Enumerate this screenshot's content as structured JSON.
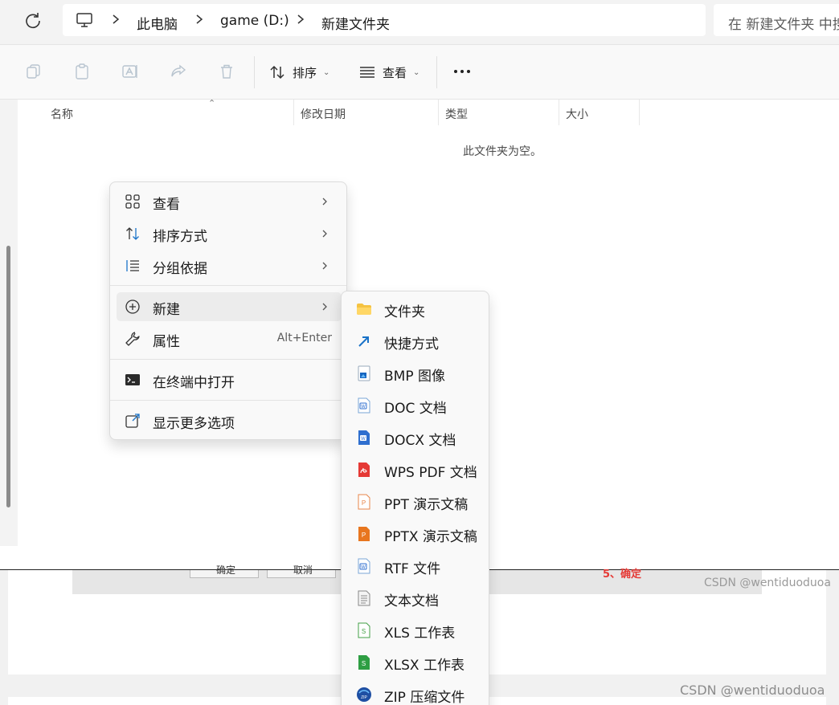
{
  "address_bar": {
    "breadcrumbs": [
      "此电脑",
      "game (D:)",
      "新建文件夹"
    ],
    "search_placeholder": "在 新建文件夹 中搜索"
  },
  "toolbar": {
    "sort_label": "排序",
    "view_label": "查看"
  },
  "columns": [
    "名称",
    "修改日期",
    "类型",
    "大小"
  ],
  "empty_message": "此文件夹为空。",
  "context_menu": {
    "items": [
      {
        "label": "查看",
        "icon": "grid-icon"
      },
      {
        "label": "排序方式",
        "icon": "sort-icon"
      },
      {
        "label": "分组依据",
        "icon": "group-icon"
      },
      {
        "label": "新建",
        "icon": "plus-circle-icon"
      },
      {
        "label": "属性",
        "icon": "wrench-icon",
        "shortcut": "Alt+Enter"
      },
      {
        "label": "在终端中打开",
        "icon": "terminal-icon"
      },
      {
        "label": "显示更多选项",
        "icon": "external-link-icon"
      }
    ]
  },
  "new_submenu": {
    "items": [
      {
        "label": "文件夹",
        "icon": "folder-icon"
      },
      {
        "label": "快捷方式",
        "icon": "shortcut-icon"
      },
      {
        "label": "BMP 图像",
        "icon": "bmp-file-icon"
      },
      {
        "label": "DOC 文档",
        "icon": "doc-file-icon"
      },
      {
        "label": "DOCX 文档",
        "icon": "docx-file-icon"
      },
      {
        "label": "WPS PDF 文档",
        "icon": "pdf-file-icon"
      },
      {
        "label": "PPT 演示文稿",
        "icon": "ppt-file-icon"
      },
      {
        "label": "PPTX 演示文稿",
        "icon": "pptx-file-icon"
      },
      {
        "label": "RTF 文件",
        "icon": "rtf-file-icon"
      },
      {
        "label": "文本文档",
        "icon": "txt-file-icon"
      },
      {
        "label": "XLS 工作表",
        "icon": "xls-file-icon"
      },
      {
        "label": "XLSX 工作表",
        "icon": "xlsx-file-icon"
      },
      {
        "label": "ZIP 压缩文件",
        "icon": "zip-file-icon"
      }
    ]
  },
  "background_window": {
    "button_labels": [
      "确定",
      "取消"
    ],
    "red_text": "5、确定"
  },
  "watermarks": {
    "inner": "CSDN @wentiduoduoa",
    "outer": "CSDN @wentiduoduoa"
  }
}
